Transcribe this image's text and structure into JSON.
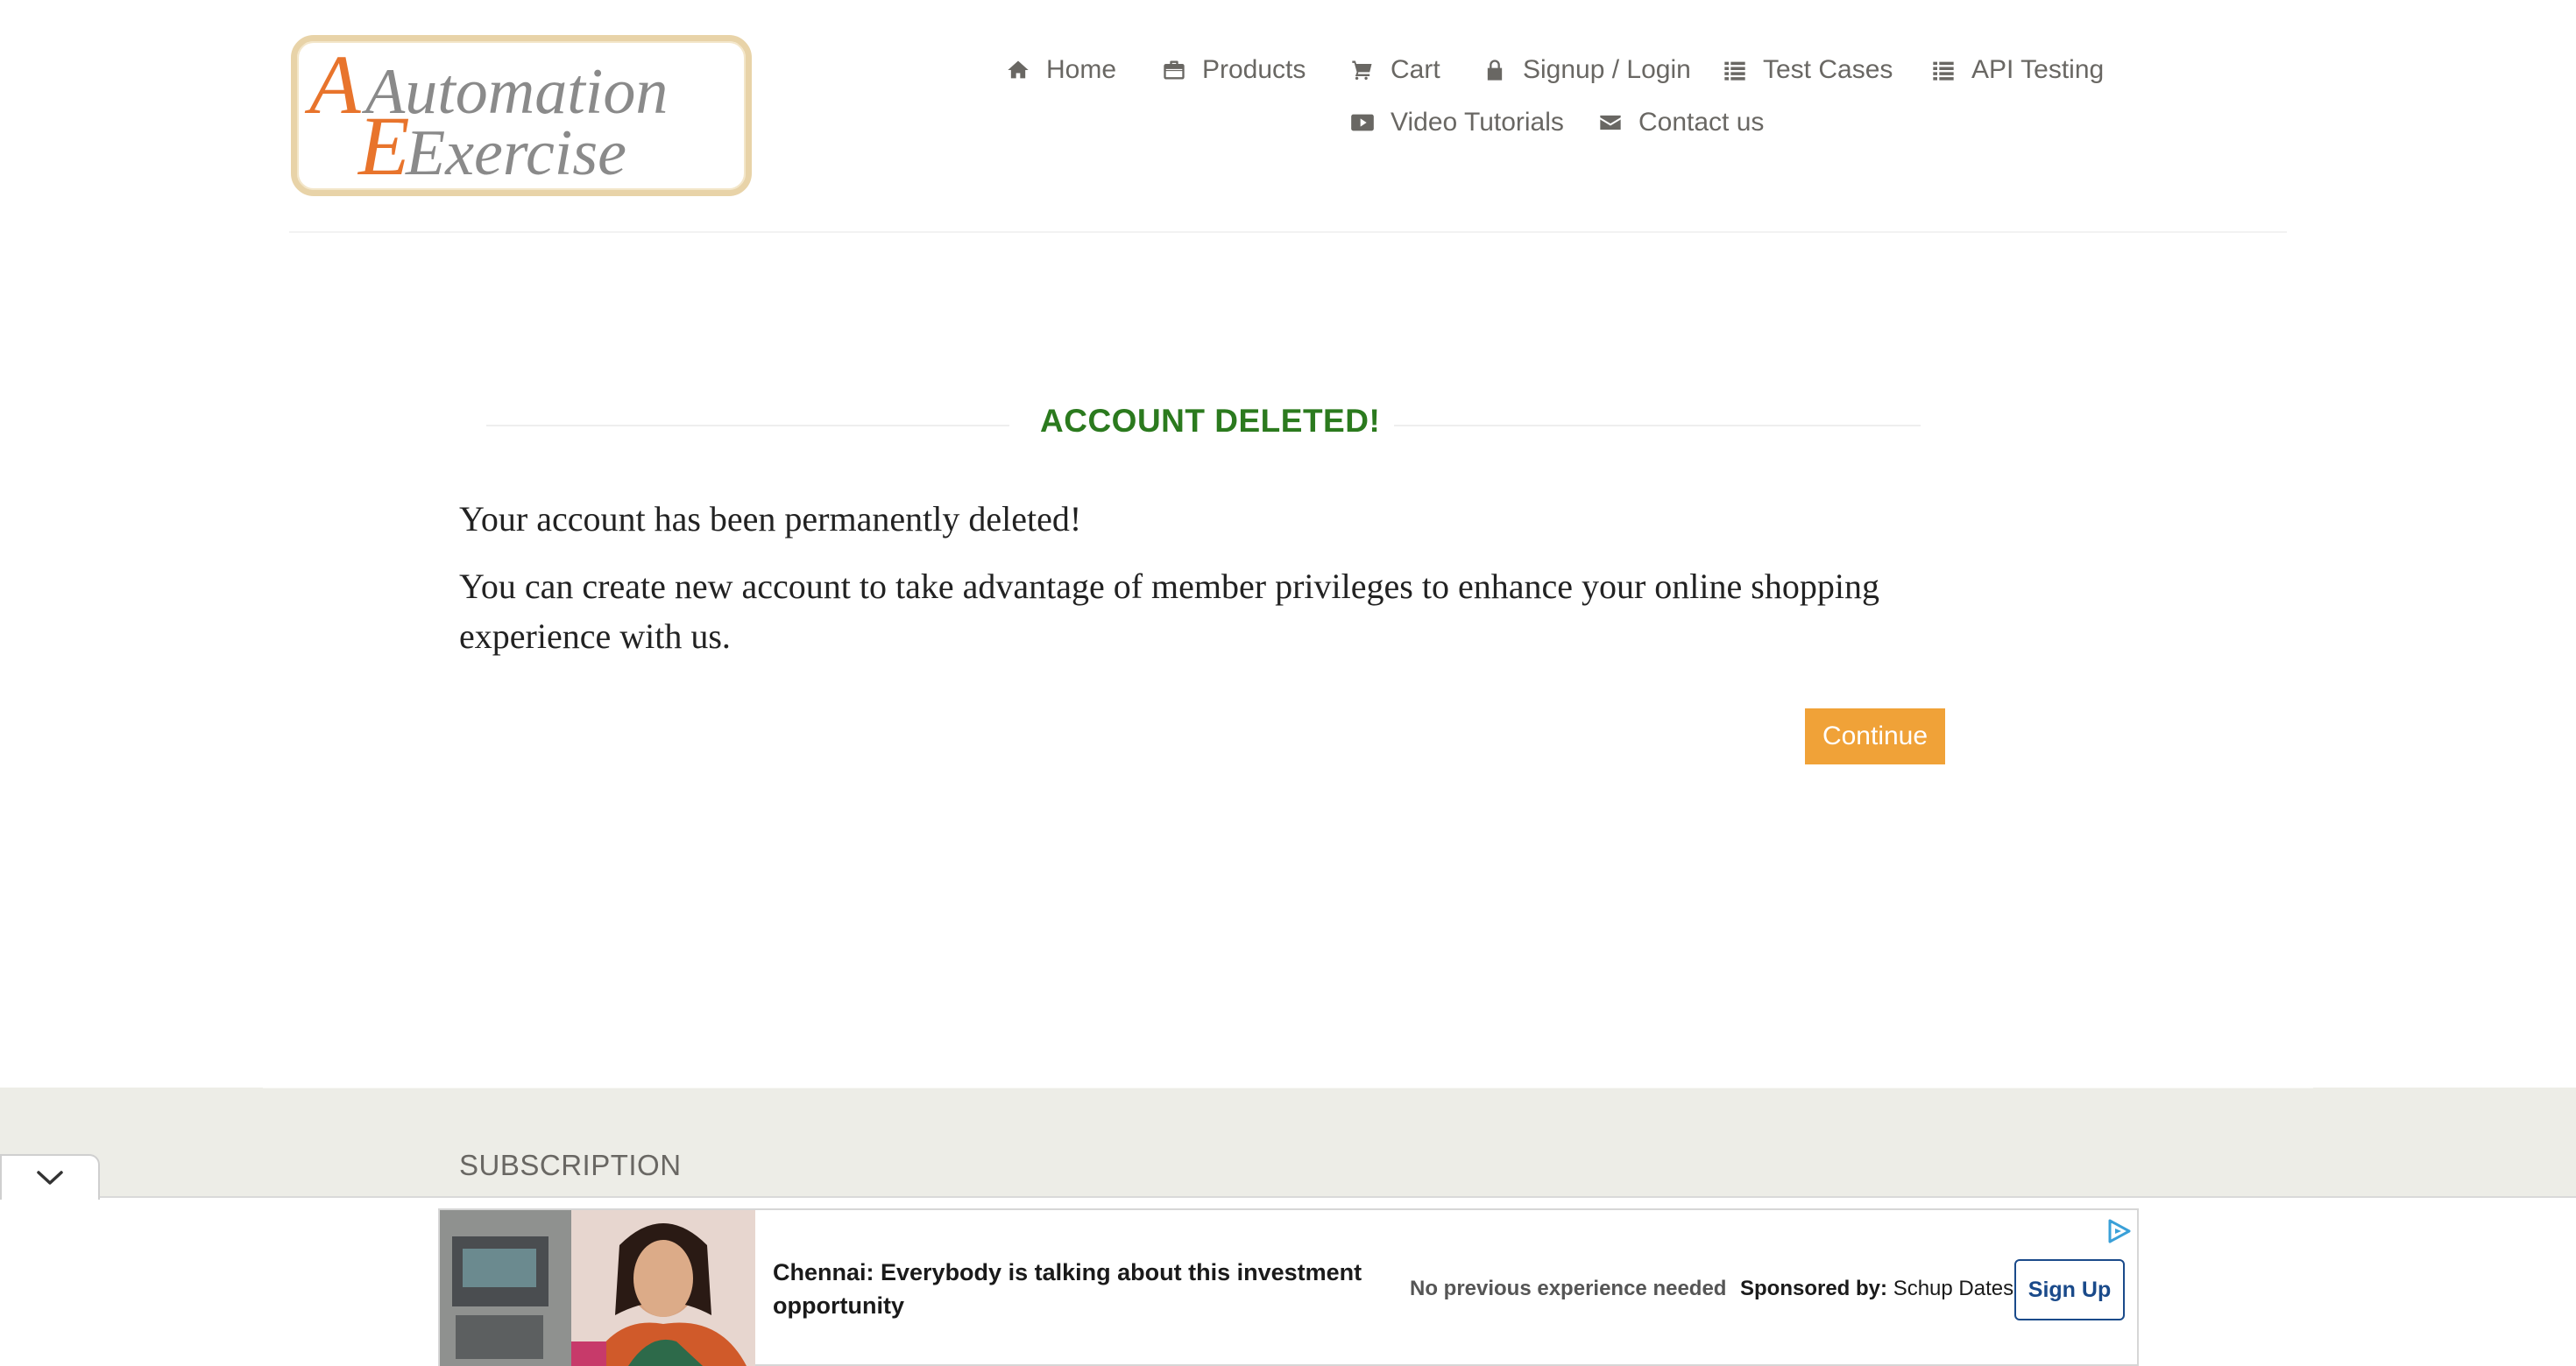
{
  "logo": {
    "line1": "Automation",
    "line2": "Exercise"
  },
  "nav": [
    {
      "label": "Home",
      "icon": "home-icon"
    },
    {
      "label": "Products",
      "icon": "briefcase-icon"
    },
    {
      "label": "Cart",
      "icon": "cart-icon"
    },
    {
      "label": "Signup / Login",
      "icon": "lock-icon"
    },
    {
      "label": "Test Cases",
      "icon": "list-icon"
    },
    {
      "label": "API Testing",
      "icon": "list-icon"
    },
    {
      "label": "Video Tutorials",
      "icon": "youtube-play-icon"
    },
    {
      "label": "Contact us",
      "icon": "envelope-icon"
    }
  ],
  "main": {
    "title": "ACCOUNT DELETED!",
    "message1": "Your account has been permanently deleted!",
    "message2": "You can create new account to take advantage of member privileges to enhance your online shopping experience with us.",
    "continue_label": "Continue"
  },
  "footer": {
    "subscription_heading": "SUBSCRIPTION"
  },
  "ad": {
    "headline": "Chennai: Everybody is talking about this investment opportunity",
    "subtext": "No previous experience needed",
    "sponsor_prefix": "Sponsored by:",
    "sponsor_name": "Schup Dates",
    "cta_label": "Sign Up",
    "collapse_icon": "chevron-down-icon",
    "adchoices_icon": "adchoices-icon"
  },
  "colors": {
    "title_green": "#2b7a1e",
    "continue_orange": "#f0a238",
    "nav_text": "#696763",
    "footer_bg": "#edede7",
    "cta_blue": "#1a4a8a"
  }
}
